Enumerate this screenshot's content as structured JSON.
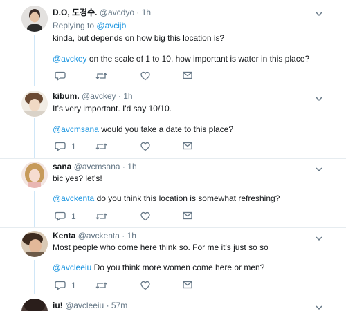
{
  "tweets": [
    {
      "name": "D.O, 도경수.",
      "handle": "@avcdyo",
      "time": "1h",
      "reply_prefix": "Replying to",
      "reply_to": "@avcijb",
      "text": "kinda, but depends on how big this location is?",
      "mention": "@avckey",
      "mention_text": "on the scale of 1 to 10, how important is water in this place?",
      "reply_count": ""
    },
    {
      "name": "kibum.",
      "handle": "@avckey",
      "time": "1h",
      "text": "It's very important. I'd say 10/10.",
      "mention": "@avcmsana",
      "mention_text": "would you take a date to this place?",
      "reply_count": "1"
    },
    {
      "name": "sana",
      "handle": "@avcmsana",
      "time": "1h",
      "text": "bic yes? let's!",
      "mention": "@avckenta",
      "mention_text": "do you think this location is somewhat refreshing?",
      "reply_count": "1"
    },
    {
      "name": "Kenta",
      "handle": "@avckenta",
      "time": "1h",
      "text": "Most people who come here think so. For me it's just so so",
      "mention": "@avcleeiu",
      "mention_text": "Do you think more women come here or men?",
      "reply_count": "1"
    },
    {
      "name": "iu!",
      "handle": "@avcleeiu",
      "time": "57m"
    }
  ],
  "separator_dot": "·",
  "icons": [
    "reply-icon",
    "retweet-icon",
    "like-icon",
    "direct-message-icon",
    "chevron-down-icon"
  ],
  "colors": {
    "link": "#1b95e0",
    "muted": "#657786",
    "text": "#14171a",
    "thread": "#cfe6f7",
    "divider": "#e6ecf0"
  }
}
